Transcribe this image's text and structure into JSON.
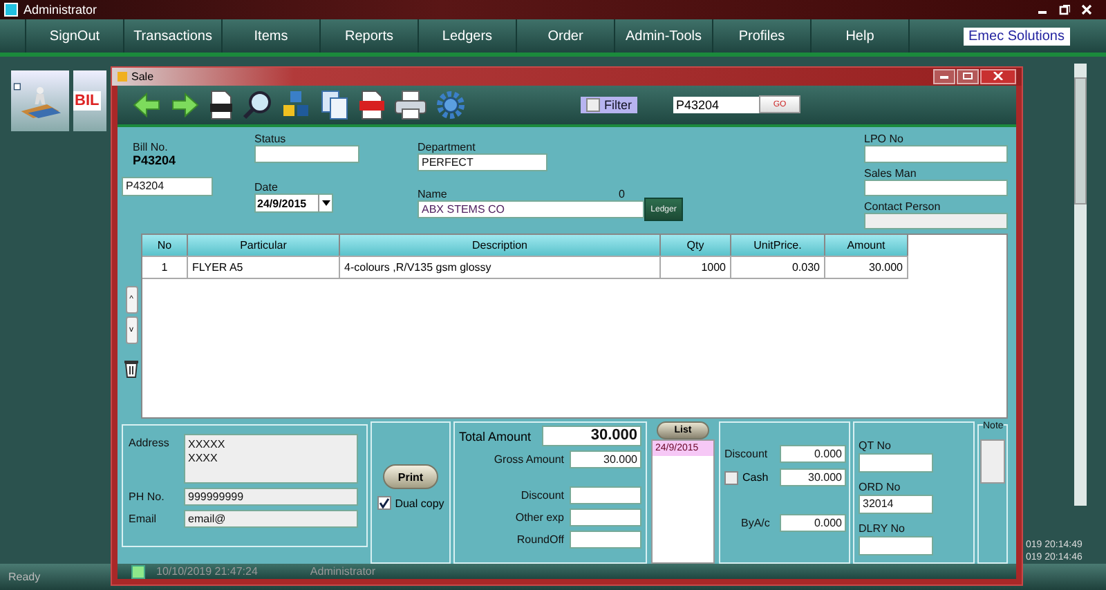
{
  "app": {
    "title": "Administrator",
    "menu": [
      "SignOut",
      "Transactions",
      "Items",
      "Reports",
      "Ledgers",
      "Order",
      "Admin-Tools",
      "Profiles",
      "Help"
    ],
    "brand": "Emec Solutions",
    "tile_label": "BIL",
    "status": "Ready",
    "clock_lines": [
      "019 20:14:49",
      "019 20:14:46"
    ]
  },
  "sale_window": {
    "title": "Sale",
    "filter": {
      "label": "Filter",
      "checked": false
    },
    "search_value": "P43204",
    "go_label": "GO",
    "header": {
      "bill_no_label": "Bill No.",
      "bill_no": "P43204",
      "status_label": "Status",
      "department_label": "Department",
      "department": "PERFECT",
      "lpo_label": "LPO No",
      "sales_man_label": "Sales Man",
      "contact_label": "Contact Person",
      "bill_field": "P43204",
      "date_label": "Date",
      "date": "24/9/2015",
      "name_label": "Name",
      "name_count": "0",
      "name": "ABX STEMS CO",
      "ledger_label": "Ledger"
    },
    "table": {
      "columns": [
        "No",
        "Particular",
        "Description",
        "Qty",
        "UnitPrice.",
        "Amount"
      ],
      "rows": [
        [
          "1",
          "FLYER A5",
          "4-colours ,R/V135 gsm glossy",
          "1000",
          "0.030",
          "30.000"
        ]
      ]
    },
    "side_buttons": [
      "^",
      "v"
    ],
    "customer": {
      "address_label": "Address",
      "address_lines": [
        "XXXXX",
        "XXXX"
      ],
      "phone_label": "PH No.",
      "phone": "999999999",
      "email_label": "Email",
      "email": "email@"
    },
    "print": {
      "label": "Print",
      "dual_copy": {
        "label": "Dual copy",
        "checked": true
      }
    },
    "totals": {
      "total_label": "Total Amount",
      "total": "30.000",
      "gross_label": "Gross Amount",
      "gross": "30.000",
      "discount_label": "Discount",
      "other_label": "Other exp",
      "roundoff_label": "RoundOff"
    },
    "list": {
      "label": "List",
      "items": [
        {
          "text": "24/9/2015",
          "selected": true
        }
      ]
    },
    "payment": {
      "discount_label": "Discount",
      "discount": "0.000",
      "cash": {
        "label": "Cash",
        "checked": false
      },
      "cash_value": "30.000",
      "byac_label": "ByA/c",
      "byac": "0.000"
    },
    "refs": {
      "qt_label": "QT No",
      "ord_label": "ORD No",
      "ord": "32014",
      "dlry_label": "DLRY No"
    },
    "note_label": "Note",
    "status_bar": {
      "time": "10/10/2019 21:47:24",
      "user": "Administrator"
    }
  }
}
